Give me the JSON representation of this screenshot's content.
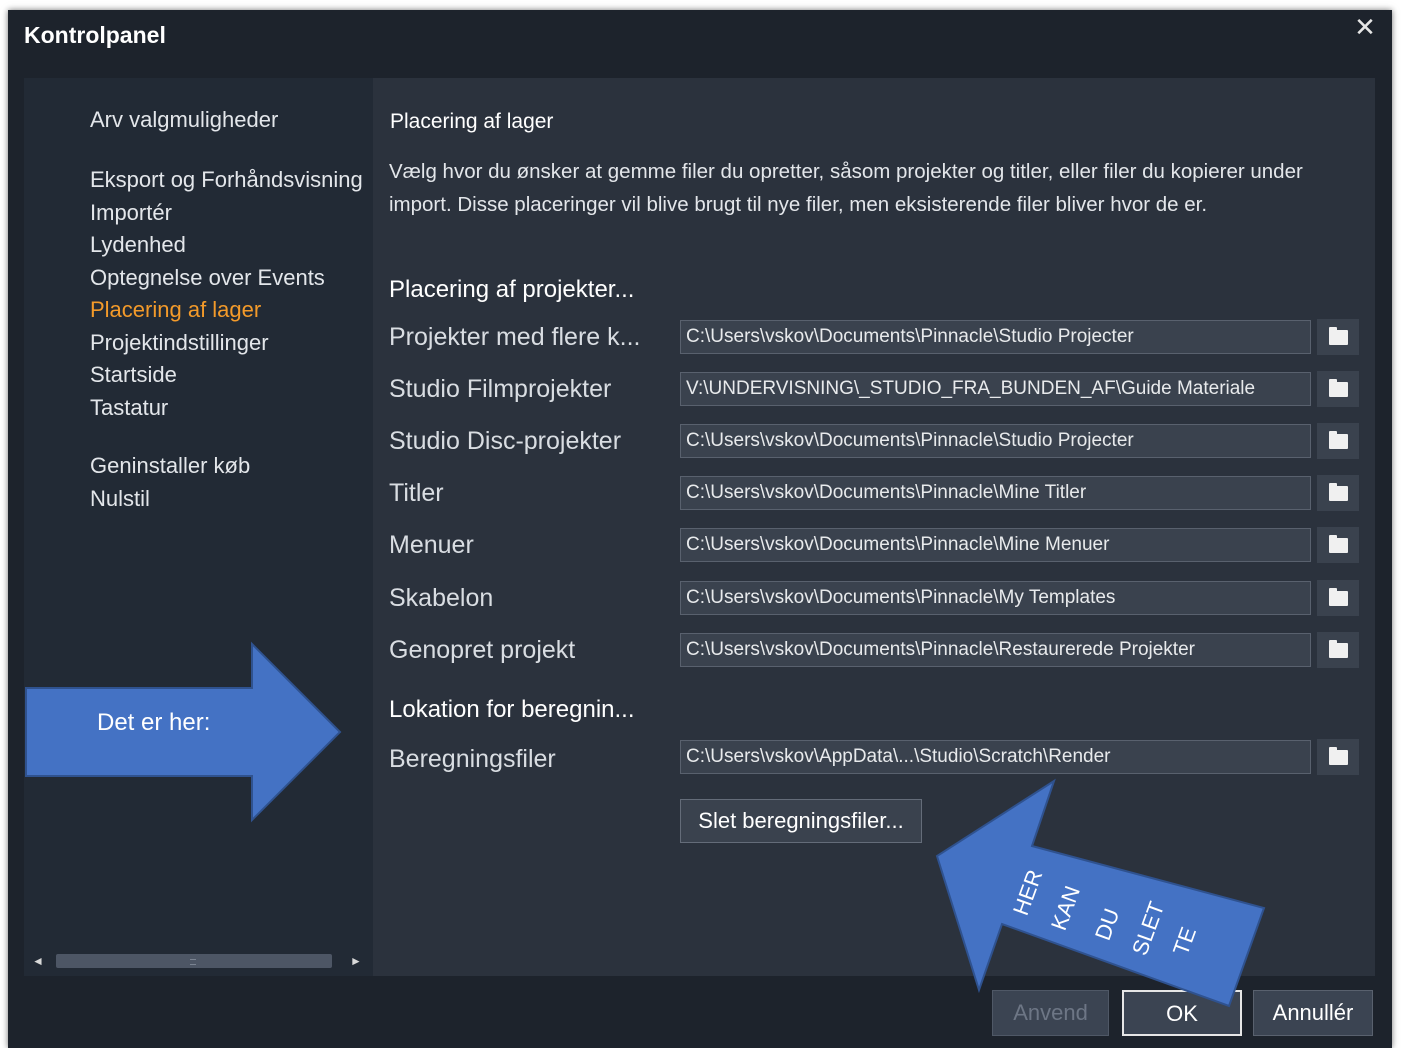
{
  "window": {
    "title": "Kontrolpanel",
    "close_glyph": "✕"
  },
  "sidebar": {
    "groups": [
      {
        "items": [
          {
            "label": "Arv valgmuligheder"
          }
        ]
      },
      {
        "items": [
          {
            "label": "Eksport og Forhåndsvisning"
          },
          {
            "label": "Importér"
          },
          {
            "label": "Lydenhed"
          },
          {
            "label": "Optegnelse over Events"
          },
          {
            "label": "Placering af lager",
            "active": true
          },
          {
            "label": "Projektindstillinger"
          },
          {
            "label": "Startside"
          },
          {
            "label": "Tastatur"
          }
        ]
      },
      {
        "items": [
          {
            "label": "Geninstaller køb"
          },
          {
            "label": "Nulstil"
          }
        ]
      }
    ],
    "scroll_left_glyph": "◄",
    "scroll_right_glyph": "►"
  },
  "content": {
    "title": "Placering af lager",
    "description": "Vælg hvor du ønsker at gemme filer du opretter, såsom projekter og titler, eller filer du kopierer under import. Disse placeringer vil blive brugt til nye filer, men eksisterende filer bliver hvor de er.",
    "projects_section": "Placering af projekter...",
    "project_rows": [
      {
        "label": "Projekter med flere k...",
        "path": "C:\\Users\\vskov\\Documents\\Pinnacle\\Studio Projecter"
      },
      {
        "label": "Studio Filmprojekter",
        "path": "V:\\UNDERVISNING\\_STUDIO_FRA_BUNDEN_AF\\Guide Materiale"
      },
      {
        "label": "Studio Disc-projekter",
        "path": "C:\\Users\\vskov\\Documents\\Pinnacle\\Studio Projecter"
      },
      {
        "label": "Titler",
        "path": "C:\\Users\\vskov\\Documents\\Pinnacle\\Mine Titler"
      },
      {
        "label": "Menuer",
        "path": "C:\\Users\\vskov\\Documents\\Pinnacle\\Mine Menuer"
      },
      {
        "label": "Skabelon",
        "path": "C:\\Users\\vskov\\Documents\\Pinnacle\\My Templates"
      },
      {
        "label": "Genopret projekt",
        "path": "C:\\Users\\vskov\\Documents\\Pinnacle\\Restaurerede Projekter"
      }
    ],
    "render_section": "Lokation for beregnin...",
    "render_row": {
      "label": "Beregningsfiler",
      "path": "C:\\Users\\vskov\\AppData\\...\\Studio\\Scratch\\Render"
    },
    "delete_button": "Slet beregningsfiler..."
  },
  "footer": {
    "apply": "Anvend",
    "ok": "OK",
    "cancel": "Annullér"
  },
  "annotations": {
    "arrow_right_text": "Det er her:",
    "arrow_diag_words": [
      "HER",
      "KAN",
      "DU",
      "SLET",
      "TE"
    ],
    "arrow_color": "#4472c4",
    "arrow_outline": "#2f528f"
  },
  "icons": {
    "folder": "folder-icon",
    "close": "close-icon",
    "scroll_left": "scroll-left-icon",
    "scroll_right": "scroll-right-icon"
  },
  "colors": {
    "accent": "#f39a2a",
    "window_bg": "#1d232c",
    "sidebar_bg": "#222a35",
    "content_bg": "#2b323d",
    "input_bg": "#3a424e"
  }
}
